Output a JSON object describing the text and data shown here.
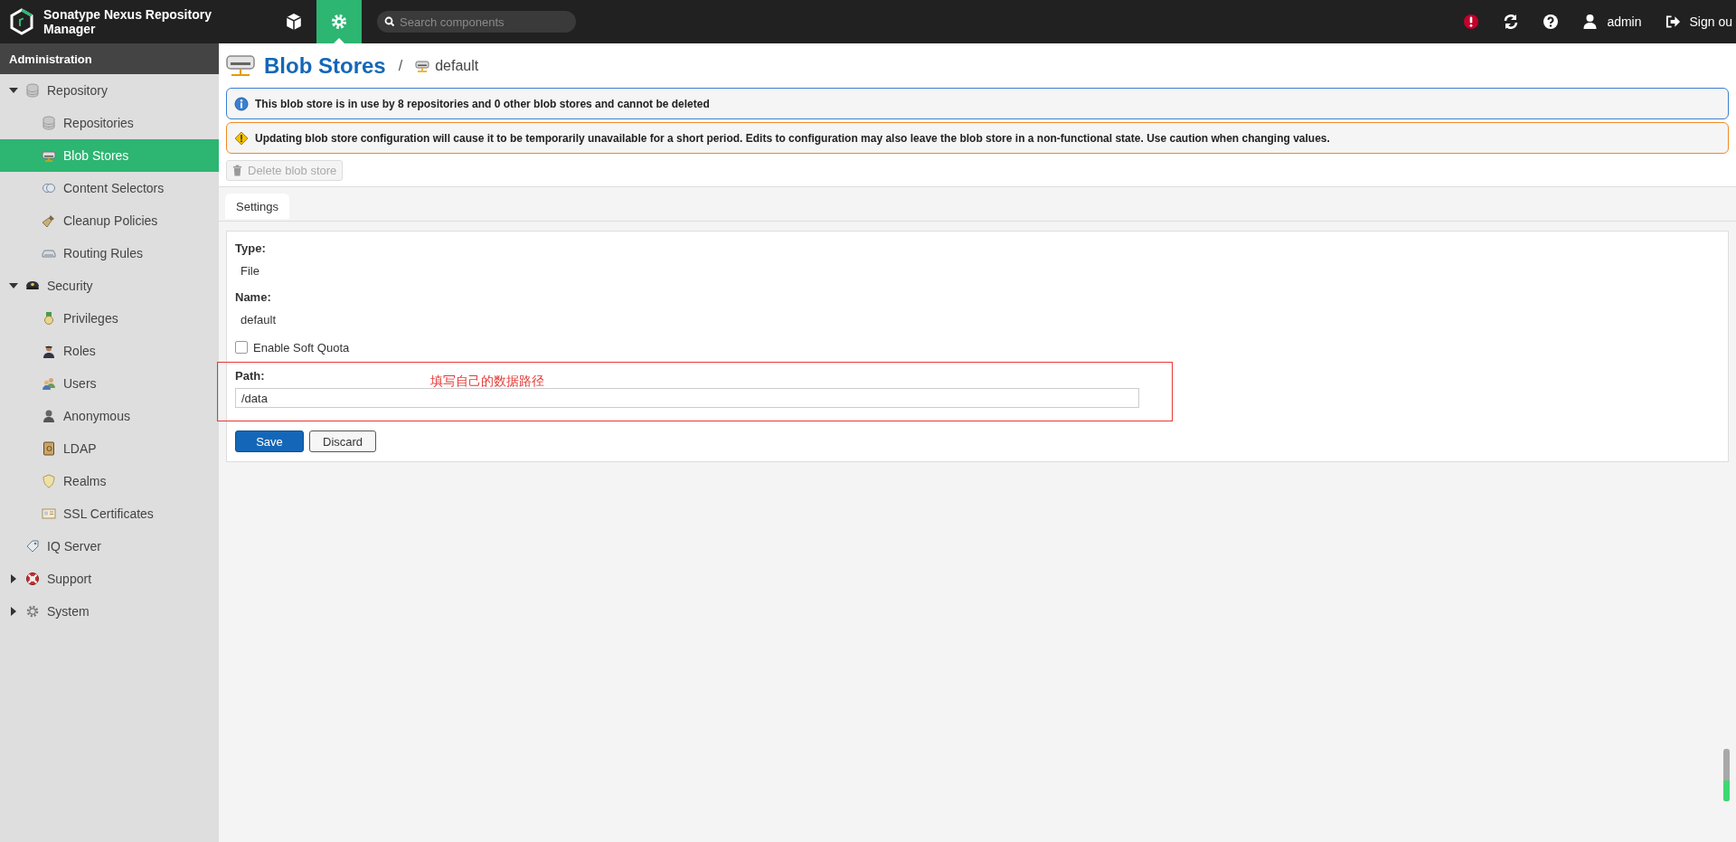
{
  "header": {
    "title": "Sonatype Nexus Repository Manager",
    "nav": [
      {
        "kind": "browse",
        "selected": false
      },
      {
        "kind": "admin",
        "selected": true
      }
    ],
    "search": {
      "placeholder": "Search components"
    },
    "user": "admin",
    "signout": "Sign ou"
  },
  "sidebar": {
    "title": "Administration",
    "items": [
      {
        "label": "Repository",
        "expanded": true,
        "selected": false,
        "children": [
          {
            "label": "Repositories",
            "selected": false
          },
          {
            "label": "Blob Stores",
            "selected": true
          },
          {
            "label": "Content Selectors",
            "selected": false
          },
          {
            "label": "Cleanup Policies",
            "selected": false
          },
          {
            "label": "Routing Rules",
            "selected": false
          }
        ]
      },
      {
        "label": "Security",
        "expanded": true,
        "selected": false,
        "children": [
          {
            "label": "Privileges",
            "selected": false
          },
          {
            "label": "Roles",
            "selected": false
          },
          {
            "label": "Users",
            "selected": false
          },
          {
            "label": "Anonymous",
            "selected": false
          },
          {
            "label": "LDAP",
            "selected": false
          },
          {
            "label": "Realms",
            "selected": false
          },
          {
            "label": "SSL Certificates",
            "selected": false
          }
        ]
      },
      {
        "label": "IQ Server",
        "selected": false
      },
      {
        "label": "Support",
        "expanded": false,
        "selected": false
      },
      {
        "label": "System",
        "expanded": false,
        "selected": false
      }
    ]
  },
  "page": {
    "title": "Blob Stores",
    "separator": "/",
    "current": "default",
    "alerts": [
      {
        "kind": "info",
        "text": "This blob store is in use by 8 repositories and 0 other blob stores and cannot be deleted"
      },
      {
        "kind": "warning",
        "text": "Updating blob store configuration will cause it to be temporarily unavailable for a short period. Edits to configuration may also leave the blob store in a non-functional state. Use caution when changing values."
      }
    ],
    "delete_button": {
      "label": "Delete blob store",
      "disabled": true
    },
    "tabs": [
      {
        "label": "Settings",
        "selected": true
      }
    ],
    "form": {
      "fields": [
        {
          "kind": "static",
          "label": "Type:",
          "value": "File"
        },
        {
          "kind": "static",
          "label": "Name:",
          "value": "default"
        },
        {
          "kind": "checkbox",
          "label": "Enable Soft Quota",
          "checked": false
        },
        {
          "kind": "text",
          "label": "Path:",
          "value": "/data",
          "annotation": "填写自己的数据路径"
        }
      ],
      "buttons": [
        {
          "label": "Save",
          "primary": true
        },
        {
          "label": "Discard",
          "primary": false
        }
      ]
    }
  },
  "meter": {
    "level": 0.4
  }
}
